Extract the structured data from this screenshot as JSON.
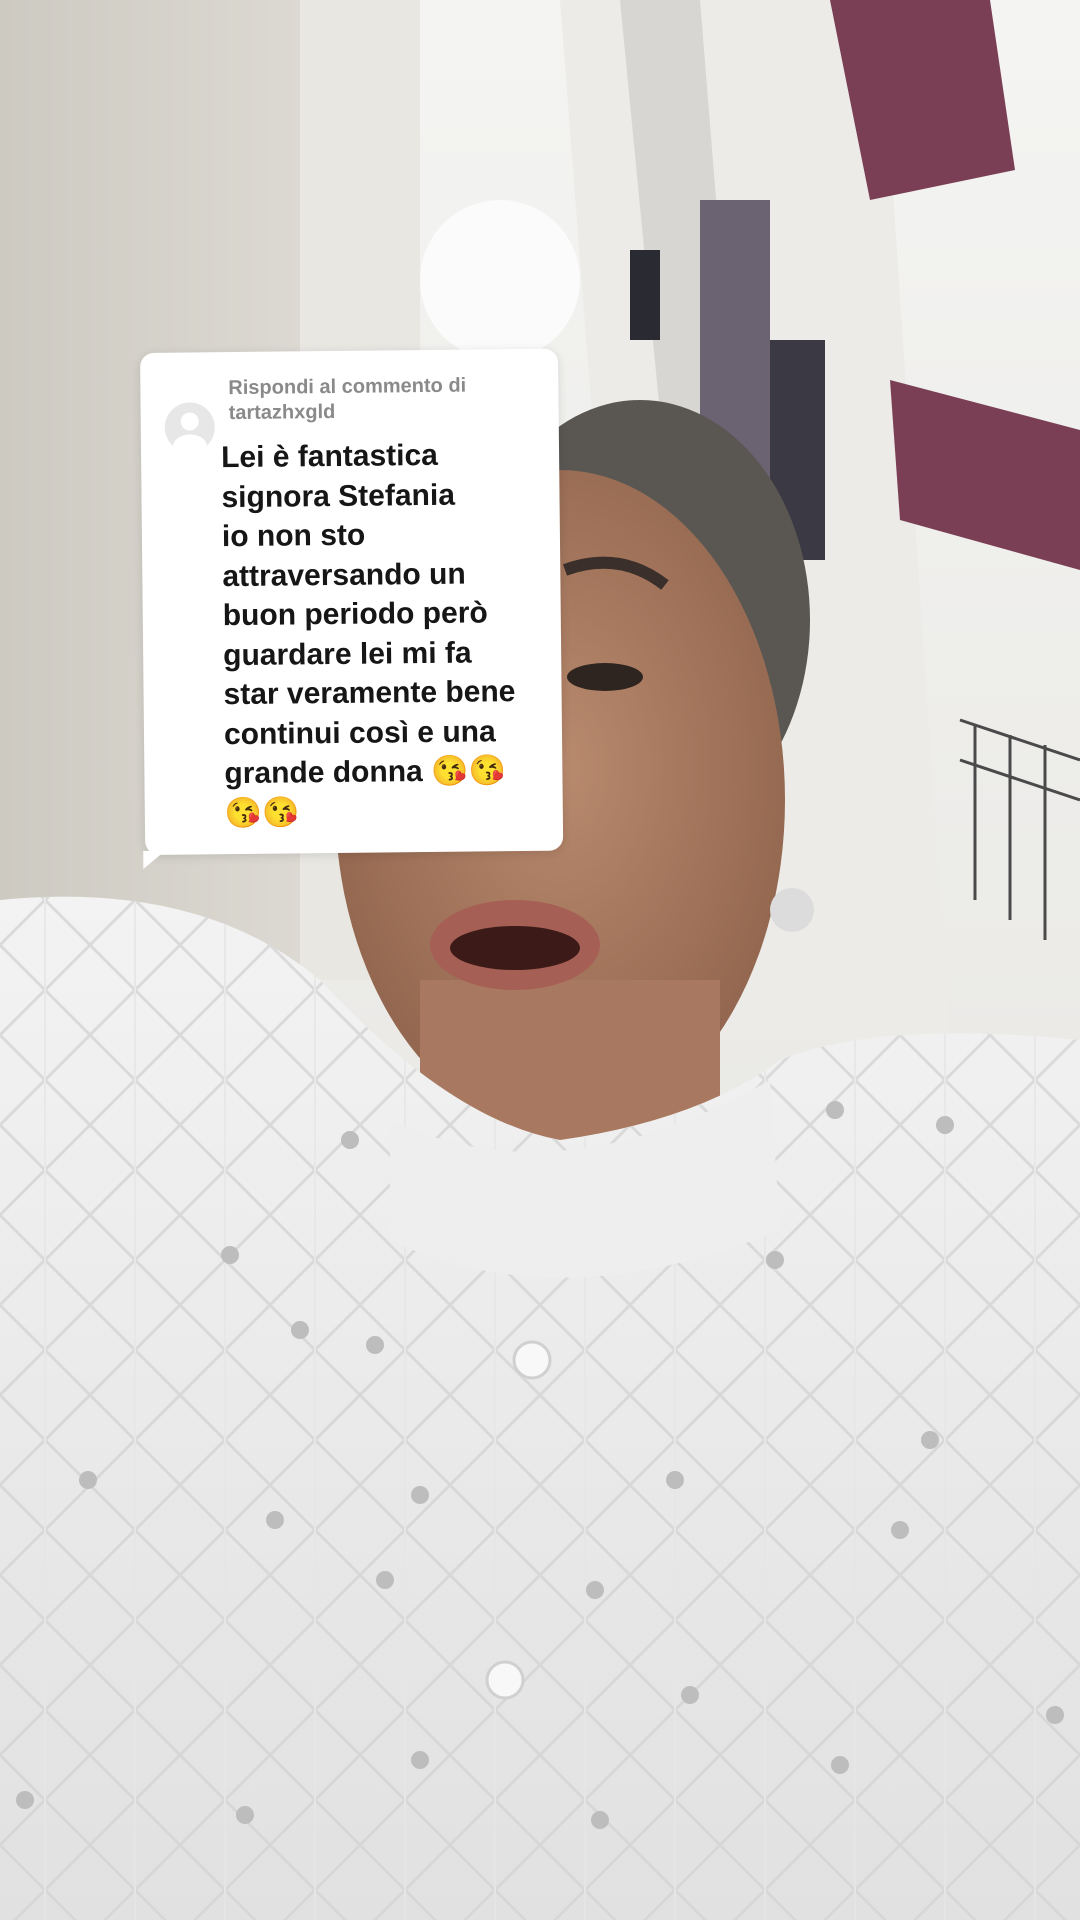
{
  "reply_card": {
    "prefix": "Rispondi al commento di",
    "username": "tartazhxgld",
    "comment_text": "Lei è fantastica\nsignora Stefania\nio non sto\nattraversando un\nbuon periodo però\nguardare lei mi fa\nstar veramente bene\ncontinui così e una\ngrande donna 😘😘\n😘😘"
  },
  "colors": {
    "card_background": "#ffffff",
    "meta_text": "#8a8a8a",
    "comment_text": "#161616",
    "awning": "#7b3f55"
  }
}
